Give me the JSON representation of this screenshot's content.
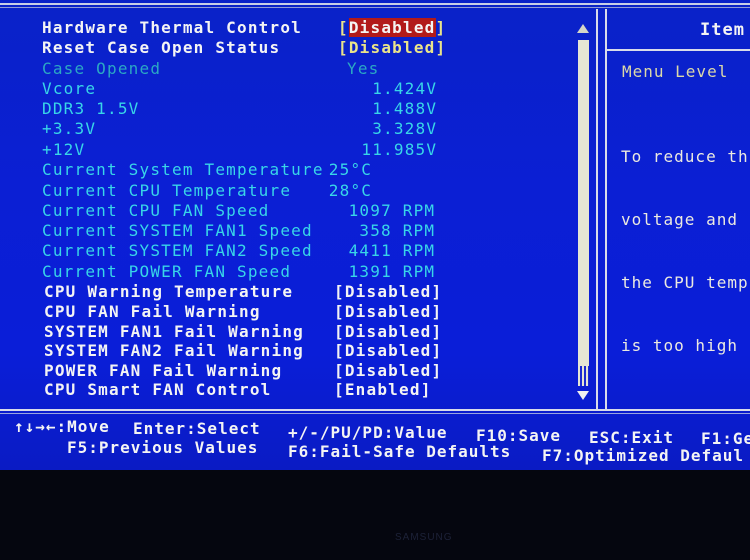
{
  "settings": [
    {
      "label": "Hardware Thermal Control",
      "value": "Disabled",
      "type": "option",
      "selected": true
    },
    {
      "label": "Reset Case Open Status",
      "value": "Disabled",
      "type": "option"
    },
    {
      "label": "Case Opened",
      "value": "Yes",
      "type": "readonly-dim"
    },
    {
      "label": "Vcore",
      "value": "1.424V",
      "type": "readonly"
    },
    {
      "label": "DDR3 1.5V",
      "value": "1.488V",
      "type": "readonly"
    },
    {
      "label": "+3.3V",
      "value": "3.328V",
      "type": "readonly"
    },
    {
      "label": "+12V",
      "value": "11.985V",
      "type": "readonly"
    },
    {
      "label": "Current System Temperature",
      "value": "25°C",
      "type": "readonly"
    },
    {
      "label": "Current CPU Temperature",
      "value": "28°C",
      "type": "readonly"
    },
    {
      "label": "Current CPU FAN Speed",
      "value": "1097 RPM",
      "type": "readonly"
    },
    {
      "label": "Current SYSTEM FAN1 Speed",
      "value": "358 RPM",
      "type": "readonly"
    },
    {
      "label": "Current SYSTEM FAN2 Speed",
      "value": "4411 RPM",
      "type": "readonly"
    },
    {
      "label": "Current POWER FAN Speed",
      "value": "1391 RPM",
      "type": "readonly"
    },
    {
      "label": "CPU Warning Temperature",
      "value": "Disabled",
      "type": "option"
    },
    {
      "label": "CPU FAN Fail Warning",
      "value": "Disabled",
      "type": "option"
    },
    {
      "label": "SYSTEM FAN1 Fail Warning",
      "value": "Disabled",
      "type": "option"
    },
    {
      "label": "SYSTEM FAN2 Fail Warning",
      "value": "Disabled",
      "type": "option"
    },
    {
      "label": "POWER FAN Fail Warning",
      "value": "Disabled",
      "type": "option"
    },
    {
      "label": "CPU Smart FAN Control",
      "value": "Enabled",
      "type": "option"
    }
  ],
  "help": {
    "title": "Item",
    "menu_level": "Menu Level",
    "text_lines": [
      "To reduce th",
      "voltage and",
      "the CPU temp",
      "is too high"
    ]
  },
  "keys": {
    "row1": [
      {
        "key": "↑↓→←",
        "action": "Move"
      },
      {
        "key": "Enter",
        "action": "Select"
      },
      {
        "key": "+/-/PU/PD",
        "action": "Value"
      },
      {
        "key": "F10",
        "action": "Save"
      },
      {
        "key": "ESC",
        "action": "Exit"
      },
      {
        "key": "F1",
        "action": "Ge"
      }
    ],
    "row2": [
      {
        "key": "F5",
        "action": "Previous Values"
      },
      {
        "key": "F6",
        "action": "Fail-Safe Defaults"
      },
      {
        "key": "F7",
        "action": "Optimized Defaul"
      }
    ]
  },
  "monitor_brand": "SAMSUNG",
  "colors": {
    "background": "#0b1fd4",
    "highlight": "#b21a1a",
    "option_text": "#f4f4f4",
    "readonly_text": "#38d6e8",
    "bracket": "#e9e48a"
  }
}
